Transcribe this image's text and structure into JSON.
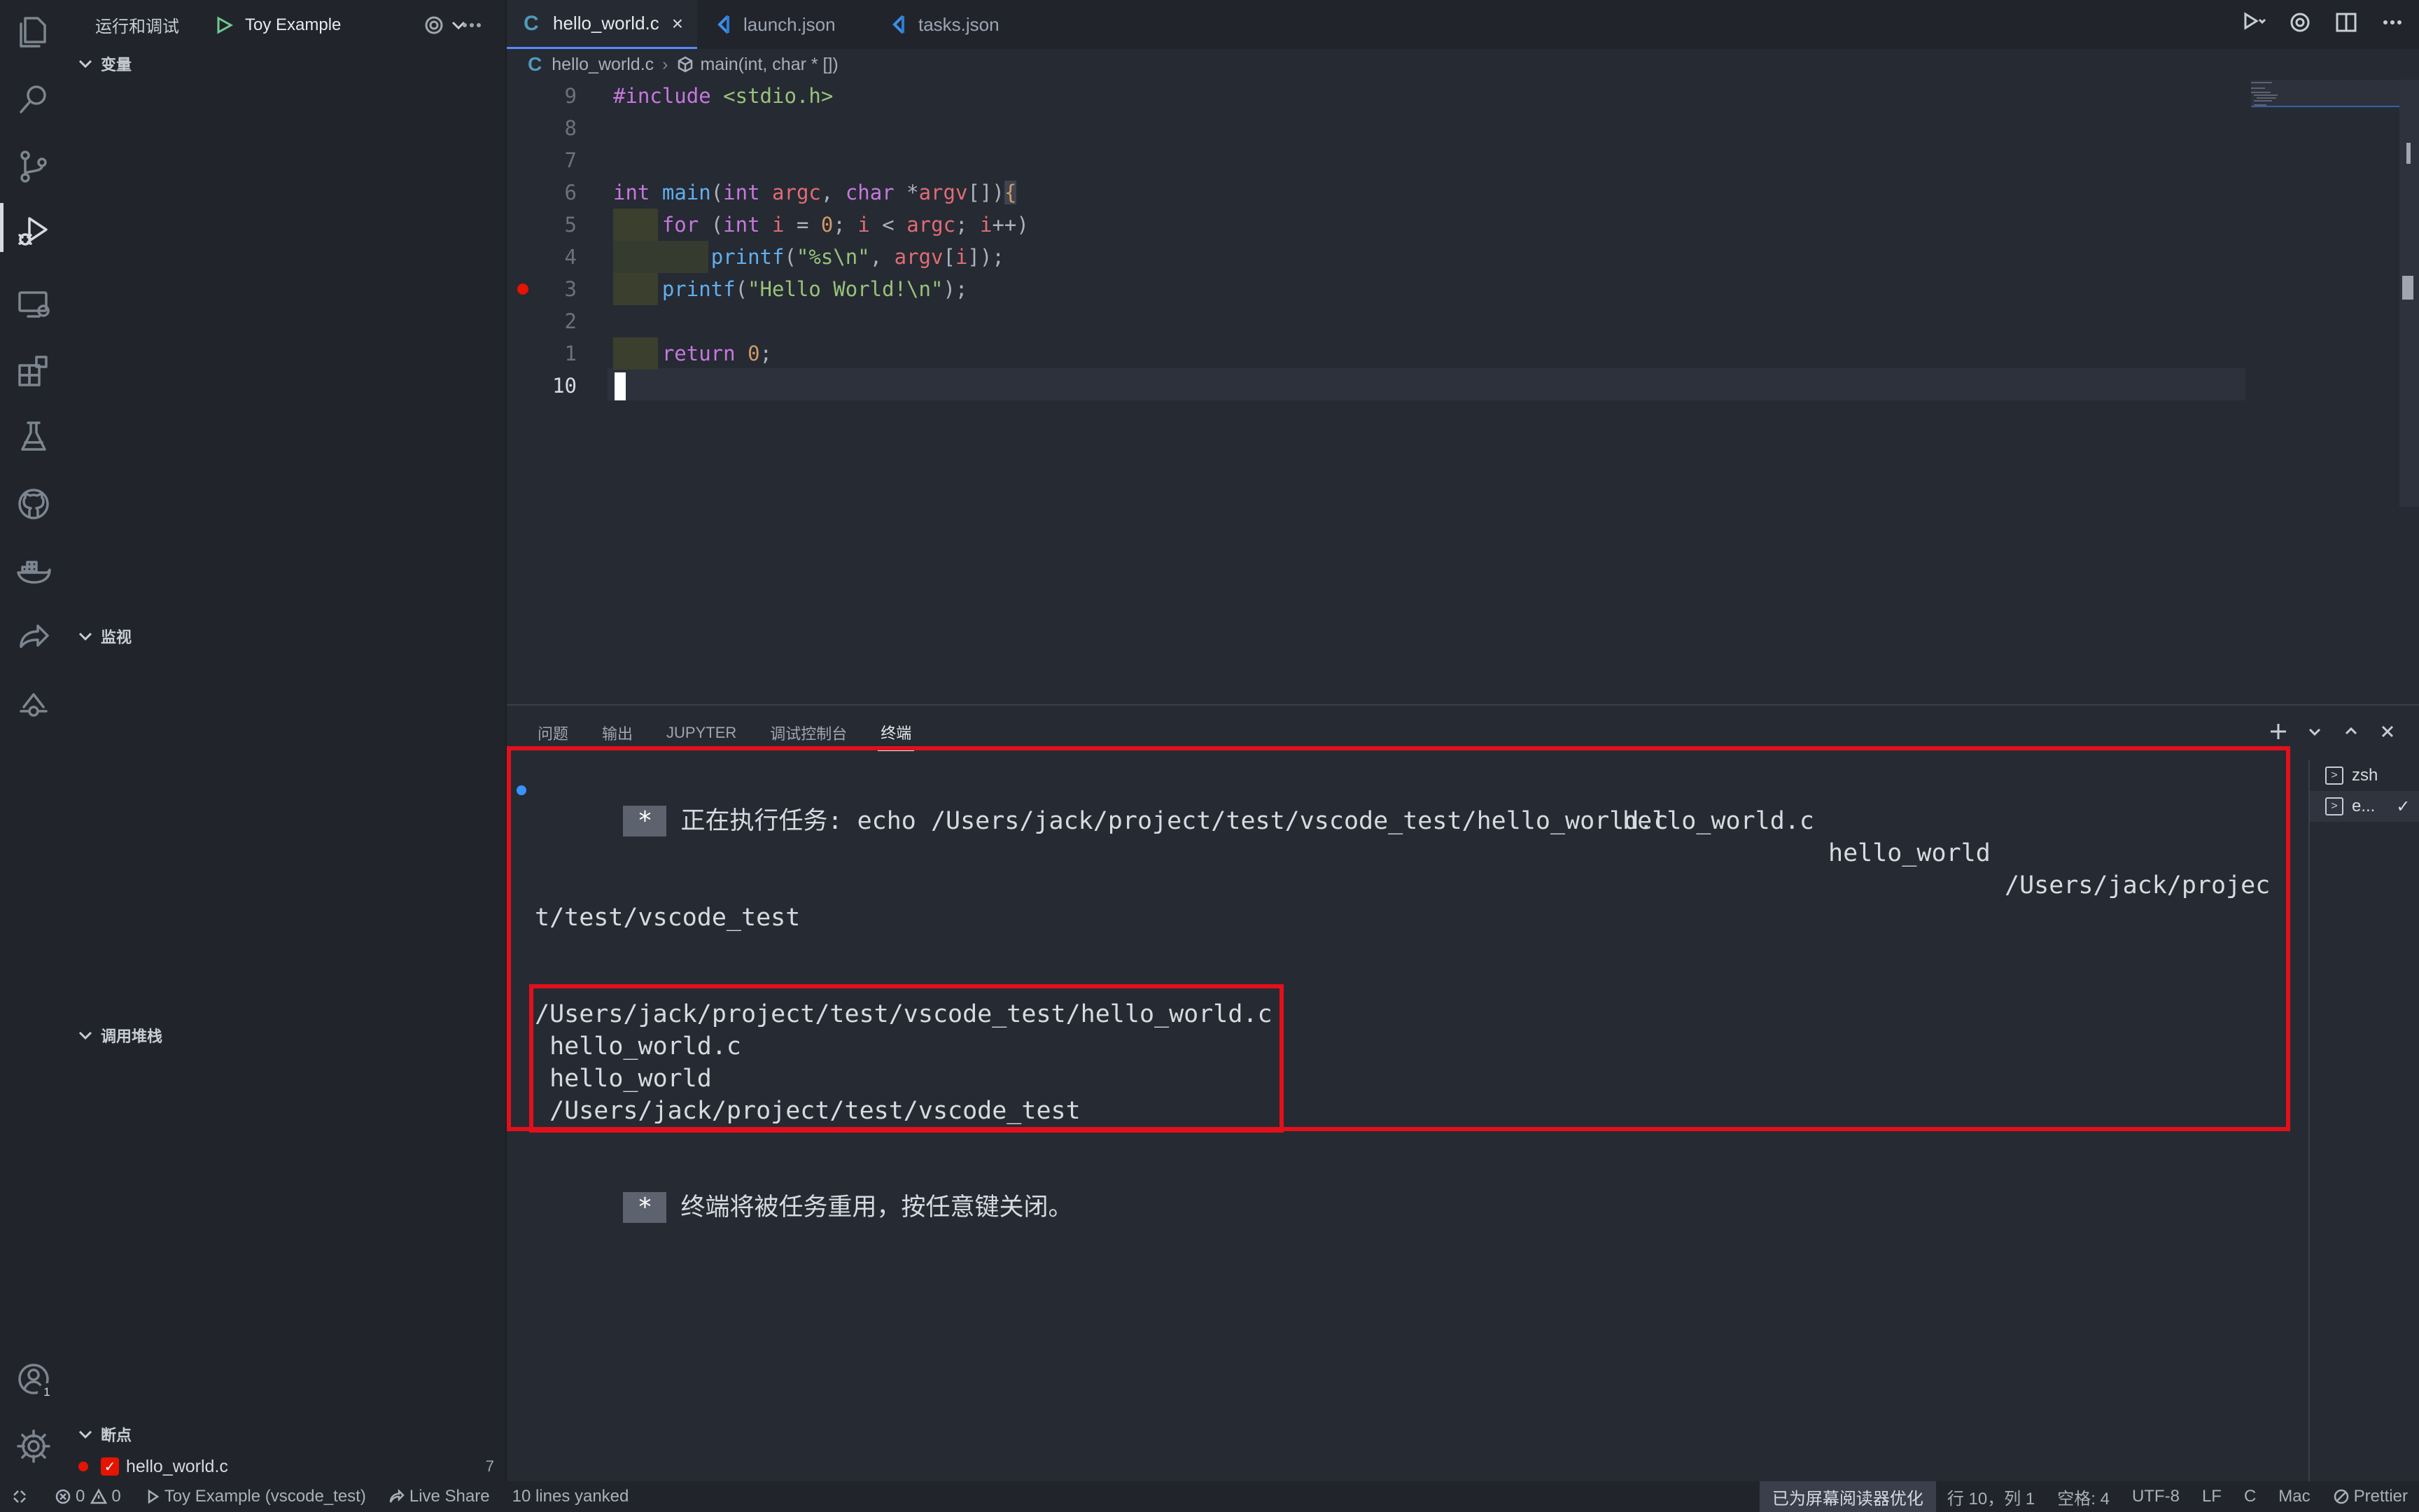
{
  "sidebar": {
    "title": "运行和调试",
    "config_name": "Toy Example",
    "sections": {
      "variables": "变量",
      "watch": "监视",
      "callstack": "调用堆栈",
      "breakpoints": "断点"
    },
    "breakpoint_file": "hello_world.c",
    "breakpoint_line": "7"
  },
  "tabs": [
    {
      "label": "hello_world.c",
      "icon": "c-file-icon",
      "active": true
    },
    {
      "label": "launch.json",
      "icon": "vscode-json-icon"
    },
    {
      "label": "tasks.json",
      "icon": "vscode-json-icon"
    }
  ],
  "breadcrumb": {
    "file": "hello_world.c",
    "symbol": "main(int, char * [])"
  },
  "editor": {
    "line_numbers": [
      "9",
      "8",
      "7",
      "6",
      "5",
      "4",
      "3",
      "2",
      "1",
      "10"
    ],
    "current_line": "10"
  },
  "panel": {
    "tabs": [
      "问题",
      "输出",
      "JUPYTER",
      "调试控制台",
      "终端"
    ],
    "active_tab": "终端",
    "terminal": {
      "line1": "正在执行任务: echo /Users/jack/project/test/vscode_test/hello_world.c",
      "line2": "hello_world.c",
      "line3": "hello_world",
      "line4": "/Users/jack/projec",
      "line5": "t/test/vscode_test",
      "out1": "/Users/jack/project/test/vscode_test/hello_world.c",
      "out2": " hello_world.c",
      "out3": " hello_world",
      "out4": " /Users/jack/project/test/vscode_test",
      "reuse": "终端将被任务重用，按任意键关闭。",
      "star": "*"
    },
    "terminal_list": [
      "zsh",
      "e..."
    ]
  },
  "statusbar": {
    "errors": "0",
    "warnings": "0",
    "debug_config": "Toy Example (vscode_test)",
    "live_share": "Live Share",
    "message": "10 lines yanked",
    "screen_reader": "已为屏幕阅读器优化",
    "position": "行 10，列 1",
    "spaces": "空格: 4",
    "encoding": "UTF-8",
    "eol": "LF",
    "language": "C",
    "platform": "Mac",
    "formatter": "Prettier"
  },
  "colors": {
    "accent": "#528bff",
    "breakpoint": "#e51400",
    "annotation_box": "#e3101c"
  },
  "account_badge": "1"
}
